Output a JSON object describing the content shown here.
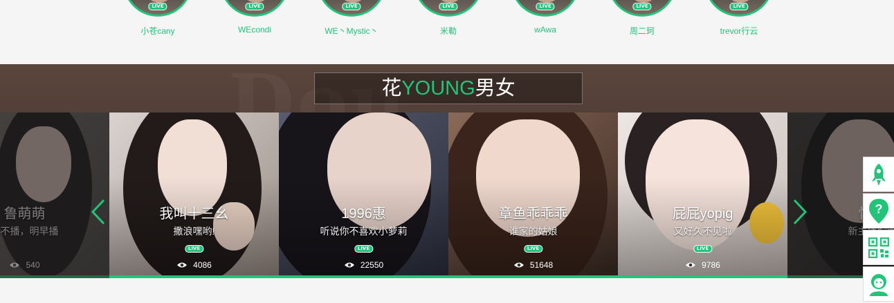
{
  "top_anchors": [
    {
      "name": "小苍cany",
      "live": "LIVE"
    },
    {
      "name": "WEcondi",
      "live": "LIVE"
    },
    {
      "name": "WE丶Mystic丶",
      "live": "LIVE"
    },
    {
      "name": "米勒",
      "live": "LIVE"
    },
    {
      "name": "wAwa",
      "live": "LIVE"
    },
    {
      "name": "周二珂",
      "live": "LIVE"
    },
    {
      "name": "trevor行云",
      "live": "LIVE"
    }
  ],
  "section": {
    "title_prefix": "花",
    "title_accent": "YOUNG",
    "title_suffix": "男女"
  },
  "cards": [
    {
      "name": "鲁萌萌",
      "desc": "晚不播，明早播",
      "views": "540",
      "state": "dimmed"
    },
    {
      "name": "我叫十三幺",
      "desc": "撒浪嘿哟!",
      "views": "4086",
      "live": "LIVE",
      "state": "active"
    },
    {
      "name": "1996惠",
      "desc": "听说你不喜欢小萝莉",
      "views": "22550",
      "live": "LIVE",
      "state": "active"
    },
    {
      "name": "章鱼乖乖乖",
      "desc": "谁家的姑娘",
      "views": "51648",
      "live": "LIVE",
      "state": "active"
    },
    {
      "name": "屁屁yopig",
      "desc": "又好久不见啦",
      "views": "9786",
      "live": "LIVE",
      "state": "active"
    },
    {
      "name": "性感",
      "desc": "新主播胸大",
      "views": "",
      "state": "dimmed"
    }
  ],
  "toolbar": {
    "icons": [
      "rocket-icon",
      "question-icon",
      "qrcode-icon",
      "service-icon"
    ]
  },
  "colors": {
    "accent": "#22c47a",
    "banner": "#4c3a33"
  }
}
